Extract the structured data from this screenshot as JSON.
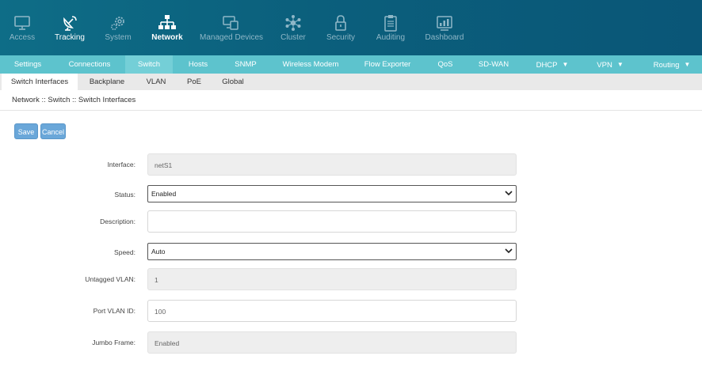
{
  "top_nav": [
    {
      "label": "Access",
      "icon": "monitor-icon"
    },
    {
      "label": "Tracking",
      "icon": "satellite-dish-icon"
    },
    {
      "label": "System",
      "icon": "gears-icon"
    },
    {
      "label": "Network",
      "icon": "network-icon"
    },
    {
      "label": "Managed Devices",
      "icon": "devices-icon"
    },
    {
      "label": "Cluster",
      "icon": "cluster-icon"
    },
    {
      "label": "Security",
      "icon": "lock-icon"
    },
    {
      "label": "Auditing",
      "icon": "clipboard-icon"
    },
    {
      "label": "Dashboard",
      "icon": "dashboard-icon"
    }
  ],
  "sec_nav": [
    {
      "label": "Settings"
    },
    {
      "label": "Connections"
    },
    {
      "label": "Switch"
    },
    {
      "label": "Hosts"
    },
    {
      "label": "SNMP"
    },
    {
      "label": "Wireless Modem"
    },
    {
      "label": "Flow Exporter"
    },
    {
      "label": "QoS"
    },
    {
      "label": "SD-WAN"
    },
    {
      "label": "DHCP"
    },
    {
      "label": "VPN"
    },
    {
      "label": "Routing"
    }
  ],
  "tabs": [
    {
      "label": "Switch Interfaces"
    },
    {
      "label": "Backplane"
    },
    {
      "label": "VLAN"
    },
    {
      "label": "PoE"
    },
    {
      "label": "Global"
    }
  ],
  "breadcrumb": "Network :: Switch :: Switch Interfaces",
  "buttons": {
    "save": "Save",
    "cancel": "Cancel"
  },
  "form": {
    "interface": {
      "label": "Interface:",
      "value": "netS1"
    },
    "status": {
      "label": "Status:",
      "value": "Enabled"
    },
    "description": {
      "label": "Description:",
      "value": ""
    },
    "speed": {
      "label": "Speed:",
      "value": "Auto"
    },
    "untagged_vlan": {
      "label": "Untagged VLAN:",
      "value": "1"
    },
    "port_vlan_id": {
      "label": "Port VLAN ID:",
      "value": "100"
    },
    "jumbo_frame": {
      "label": "Jumbo Frame:",
      "value": "Enabled"
    }
  },
  "colors": {
    "topbar": "#0b5f7c",
    "secnav": "#5dc3cd",
    "button": "#6aa7d9"
  }
}
